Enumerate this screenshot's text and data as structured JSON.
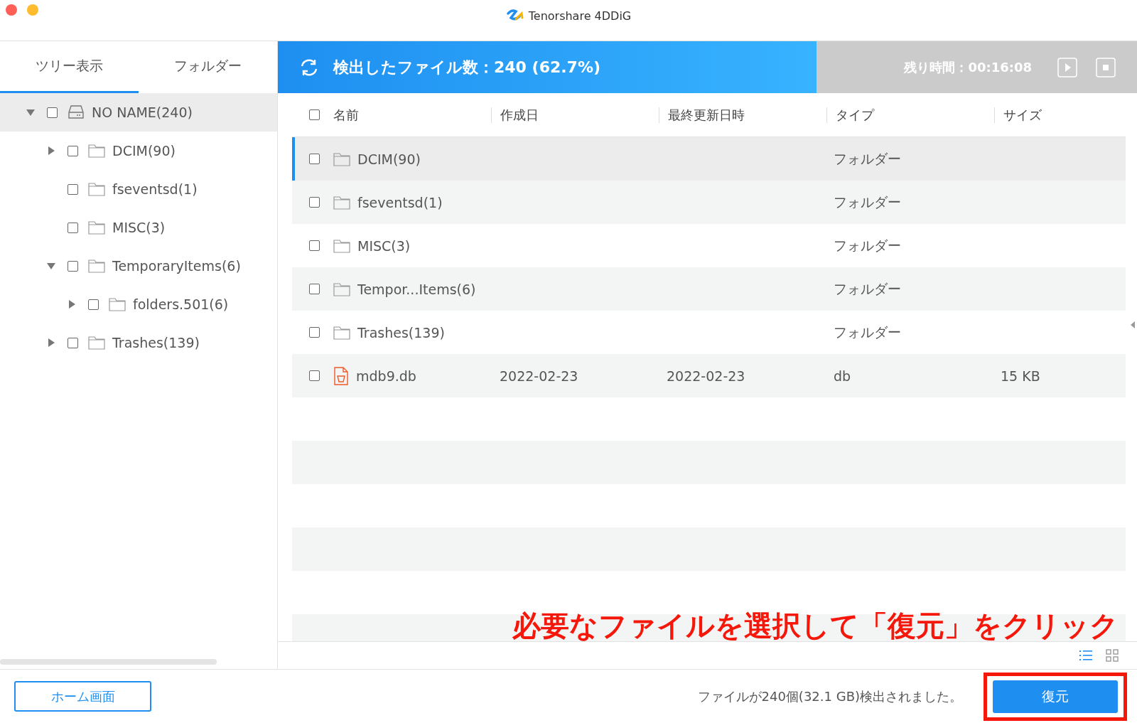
{
  "window": {
    "title": "Tenorshare 4DDiG"
  },
  "sidebar": {
    "tabs": [
      {
        "label": "ツリー表示",
        "selected": true
      },
      {
        "label": "フォルダー",
        "selected": false
      }
    ],
    "tree": [
      {
        "label": "NO NAME(240)",
        "kind": "drive",
        "expanded": true,
        "checked": false,
        "selected": true,
        "children": [
          {
            "label": "DCIM(90)",
            "kind": "folder",
            "expanded": false,
            "checked": false,
            "selected": false
          },
          {
            "label": "fseventsd(1)",
            "kind": "folder",
            "checked": false,
            "selected": false
          },
          {
            "label": "MISC(3)",
            "kind": "folder",
            "checked": false,
            "selected": false
          },
          {
            "label": "TemporaryItems(6)",
            "kind": "folder",
            "expanded": true,
            "checked": false,
            "selected": false,
            "children": [
              {
                "label": "folders.501(6)",
                "kind": "folder",
                "expanded": false,
                "checked": false,
                "selected": false
              }
            ]
          },
          {
            "label": "Trashes(139)",
            "kind": "folder",
            "expanded": false,
            "checked": false,
            "selected": false
          }
        ]
      }
    ]
  },
  "scan": {
    "status": "検出したファイル数：240 (62.7%)",
    "level": 0.627,
    "remaining": "残り時間：00:16:08"
  },
  "table": {
    "select_all": {
      "checked": false
    },
    "columns": [
      "名前",
      "作成日",
      "最終更新日時",
      "タイプ",
      "サイズ"
    ],
    "rows": [
      {
        "kind": "folder",
        "checked": false,
        "selected": true,
        "name": "DCIM(90)",
        "type": "フォルダー"
      },
      {
        "kind": "folder",
        "checked": false,
        "selected": false,
        "name": "fseventsd(1)",
        "type": "フォルダー"
      },
      {
        "kind": "folder",
        "checked": false,
        "selected": false,
        "name": "MISC(3)",
        "type": "フォルダー"
      },
      {
        "kind": "folder",
        "checked": false,
        "selected": false,
        "name": "Tempor...Items(6)",
        "type": "フォルダー"
      },
      {
        "kind": "folder",
        "checked": false,
        "selected": false,
        "name": "Trashes(139)",
        "type": "フォルダー"
      },
      {
        "kind": "file",
        "checked": false,
        "selected": false,
        "name": "mdb9.db",
        "created": "2022-02-23",
        "modified": "2022-02-23",
        "type": "db",
        "size": "15 KB"
      }
    ]
  },
  "view_modes": [
    {
      "kind": "list",
      "selected": true
    },
    {
      "kind": "grid",
      "selected": false
    }
  ],
  "annotation": "必要なファイルを選択して「復元」をクリック",
  "footer": {
    "home_button": "ホーム画面",
    "summary": "ファイルが240個(32.1 GB)検出されました。",
    "recover_button": "復元"
  }
}
